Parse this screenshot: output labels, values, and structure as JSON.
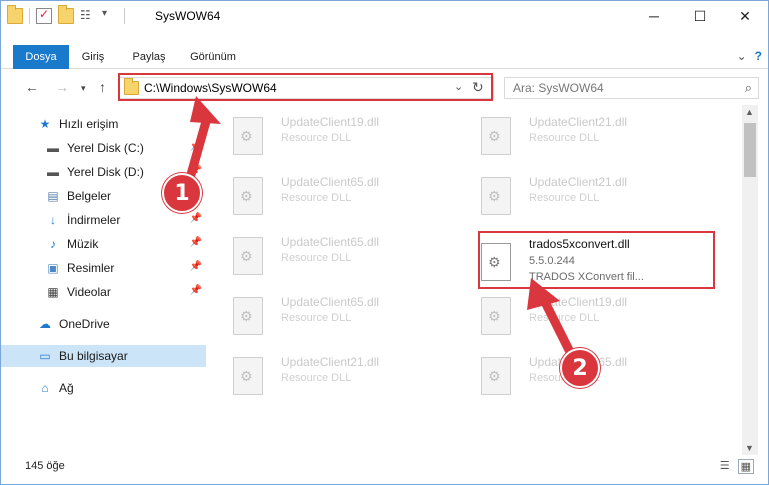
{
  "window": {
    "title": "SysWOW64"
  },
  "ribbon": {
    "tabs": [
      {
        "label": "Dosya",
        "active": true
      },
      {
        "label": "Giriş"
      },
      {
        "label": "Paylaş"
      },
      {
        "label": "Görünüm"
      }
    ],
    "help": "?"
  },
  "address": {
    "path": "C:\\Windows\\SysWOW64",
    "search_placeholder": "Ara: SysWOW64"
  },
  "nav": {
    "items": [
      {
        "label": "Hızlı erişim",
        "icon": "star-icon"
      },
      {
        "label": "Yerel Disk (C:)",
        "icon": "drive-icon",
        "pinned": true
      },
      {
        "label": "Yerel Disk (D:)",
        "icon": "drive-icon",
        "pinned": true
      },
      {
        "label": "Belgeler",
        "icon": "documents-icon",
        "pinned": true
      },
      {
        "label": "İndirmeler",
        "icon": "download-icon",
        "pinned": true
      },
      {
        "label": "Müzik",
        "icon": "music-icon",
        "pinned": true
      },
      {
        "label": "Resimler",
        "icon": "pictures-icon",
        "pinned": true
      },
      {
        "label": "Videolar",
        "icon": "videos-icon",
        "pinned": true
      },
      {
        "label": "OneDrive",
        "icon": "cloud-icon"
      },
      {
        "label": "Bu bilgisayar",
        "icon": "computer-icon",
        "selected": true
      },
      {
        "label": "Ağ",
        "icon": "network-icon"
      }
    ]
  },
  "files": [
    {
      "name": "UpdateClient19.dll",
      "desc": "Resource DLL"
    },
    {
      "name": "UpdateClient21.dll",
      "desc": "Resource DLL"
    },
    {
      "name": "UpdateClient65.dll",
      "desc": "Resource DLL"
    },
    {
      "name": "UpdateClient21.dll",
      "desc": "Resource DLL"
    },
    {
      "name": "UpdateClient65.dll",
      "desc": "Resource DLL"
    },
    {
      "name": "trados5xconvert.dll",
      "version": "5.5.0.244",
      "desc": "TRADOS XConvert fil...",
      "highlighted": true
    },
    {
      "name": "UpdateClient65.dll",
      "desc": "Resource DLL"
    },
    {
      "name": "UpdateClient19.dll",
      "desc": "Resource DLL"
    },
    {
      "name": "UpdateClient21.dll",
      "desc": "Resource DLL"
    },
    {
      "name": "UpdateClient65.dll",
      "desc": "Resource DLL"
    }
  ],
  "status": {
    "count": "145 öğe"
  },
  "annotations": {
    "badge1": "1",
    "badge2": "2",
    "color": "#d9363e"
  },
  "colors": {
    "accent": "#1979ca",
    "selected": "#cce4f7"
  }
}
